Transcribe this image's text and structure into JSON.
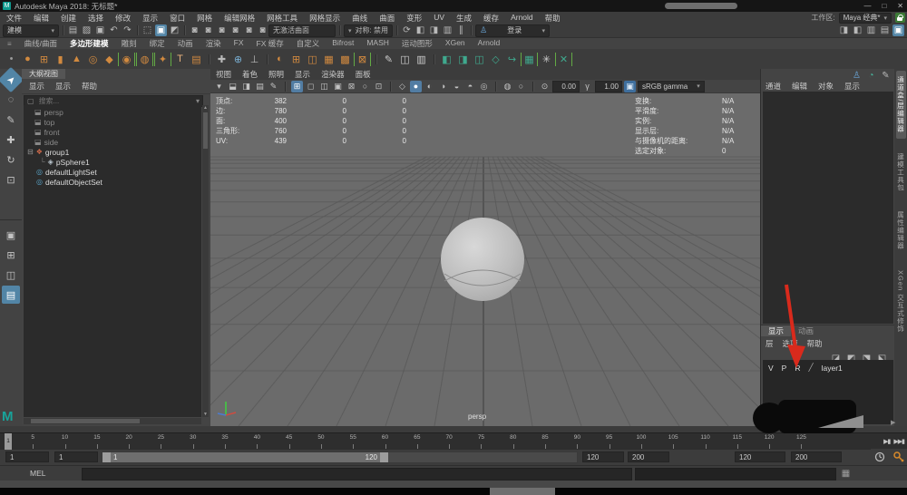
{
  "window": {
    "app_icon": "M",
    "title": "Autodesk Maya 2018: 无标题*",
    "minimize": "—",
    "maximize": "□",
    "close": "✕"
  },
  "menu_bar": {
    "items": [
      "文件",
      "编辑",
      "创建",
      "选择",
      "修改",
      "显示",
      "窗口",
      "网格",
      "编辑网格",
      "网格工具",
      "网格显示",
      "曲线",
      "曲面",
      "变形",
      "UV",
      "生成",
      "缓存",
      "Arnold",
      "帮助"
    ],
    "workspace_label": "工作区:",
    "workspace_value": "Maya 经典*"
  },
  "status_line": {
    "mode": "建模",
    "file_icons": [
      {
        "n": "new-scene-icon",
        "g": "▤"
      },
      {
        "n": "open-scene-icon",
        "g": "▨"
      },
      {
        "n": "save-scene-icon",
        "g": "▣"
      },
      {
        "n": "undo-icon",
        "g": "↶"
      },
      {
        "n": "redo-icon",
        "g": "↷"
      }
    ],
    "select_icons": [
      {
        "n": "select-hierarchy-icon",
        "g": "⬚"
      },
      {
        "n": "select-object-icon",
        "g": "▣",
        "hl": true
      },
      {
        "n": "select-component-icon",
        "g": "◩"
      }
    ],
    "snap_icons": [
      {
        "n": "snap-grid-icon",
        "g": "◙"
      },
      {
        "n": "snap-curve-icon",
        "g": "◙"
      },
      {
        "n": "snap-point-icon",
        "g": "◙"
      },
      {
        "n": "snap-projected-center-icon",
        "g": "◙"
      },
      {
        "n": "snap-view-plane-icon",
        "g": "◙"
      },
      {
        "n": "make-live-icon",
        "g": "◙"
      }
    ],
    "no_active_surface": "无激活曲面",
    "symmetry": "对称: 禁用",
    "render_icons": [
      {
        "n": "construction-history-icon",
        "g": "⟳"
      },
      {
        "n": "render-frame-icon",
        "g": "◧"
      },
      {
        "n": "ipr-render-icon",
        "g": "◨"
      },
      {
        "n": "render-settings-icon",
        "g": "▥"
      },
      {
        "n": "pause-icon",
        "g": "∥"
      }
    ],
    "login": "登录",
    "right_icons": [
      {
        "n": "attribute-editor-toggle-icon",
        "g": "◨"
      },
      {
        "n": "tool-settings-toggle-icon",
        "g": "◧"
      },
      {
        "n": "channel-box-toggle-icon",
        "g": "▥"
      },
      {
        "n": "modeling-toolkit-toggle-icon",
        "g": "▤"
      },
      {
        "n": "outliner-toggle-icon",
        "g": "▣",
        "hl": true
      }
    ]
  },
  "shelf": {
    "active_tab": "多边形建模",
    "tabs": [
      "曲线/曲面",
      "多边形建模",
      "雕刻",
      "绑定",
      "动画",
      "渲染",
      "FX",
      "FX 缓存",
      "自定义",
      "Bifrost",
      "MASH",
      "运动图形",
      "XGen",
      "Arnold"
    ],
    "icons": [
      {
        "n": "shelf-popup-icon",
        "g": "•",
        "c": "#9a9a9a"
      },
      {
        "n": "poly-sphere-icon",
        "g": "●",
        "c": "#d28a3f"
      },
      {
        "n": "poly-cube-icon",
        "g": "⊞",
        "c": "#d28a3f"
      },
      {
        "n": "poly-cylinder-icon",
        "g": "▮",
        "c": "#d28a3f"
      },
      {
        "n": "poly-cone-icon",
        "g": "▲",
        "c": "#d28a3f"
      },
      {
        "n": "poly-torus-icon",
        "g": "◎",
        "c": "#d28a3f"
      },
      {
        "n": "poly-plane-icon",
        "g": "◆",
        "c": "#d28a3f"
      },
      {
        "n": "poly-disc-icon",
        "g": "◉",
        "c": "#d28a3f",
        "br": true
      },
      {
        "n": "poly-platonic-icon",
        "g": "◍",
        "c": "#d28a3f",
        "br": true
      },
      {
        "n": "poly-superellipse-icon",
        "g": "✦",
        "c": "#d28a3f",
        "br": true
      },
      {
        "n": "poly-type-icon",
        "g": "T",
        "c": "#e8b27d"
      },
      {
        "n": "svg-tool-icon",
        "g": "▤",
        "c": "#d28a3f"
      },
      {
        "n": "sep"
      },
      {
        "n": "construction-plane-icon",
        "g": "✚",
        "c": "#b9b9b9"
      },
      {
        "n": "locator-icon",
        "g": "⊕",
        "c": "#7ab0d4"
      },
      {
        "n": "measure-distance-icon",
        "g": "⊥",
        "c": "#b9b9b9"
      },
      {
        "n": "sep"
      },
      {
        "n": "mirror-icon",
        "g": "◐",
        "c": "#d28a3f"
      },
      {
        "n": "combine-icon",
        "g": "⊞",
        "c": "#d28a3f"
      },
      {
        "n": "separate-icon",
        "g": "◫",
        "c": "#d28a3f"
      },
      {
        "n": "smooth-icon",
        "g": "▦",
        "c": "#d28a3f"
      },
      {
        "n": "reduce-icon",
        "g": "▩",
        "c": "#d28a3f"
      },
      {
        "n": "boolean-icon",
        "g": "⊠",
        "c": "#d28a3f",
        "br": true
      },
      {
        "n": "sep"
      },
      {
        "n": "quad-draw-icon",
        "g": "✎",
        "c": "#cccccc"
      },
      {
        "n": "multi-cut-icon",
        "g": "◫",
        "c": "#cccccc"
      },
      {
        "n": "insert-edge-loop-icon",
        "g": "▥",
        "c": "#cccccc"
      },
      {
        "n": "sep"
      },
      {
        "n": "extrude-icon",
        "g": "◧",
        "c": "#3fa98e"
      },
      {
        "n": "bevel-icon",
        "g": "◨",
        "c": "#3fa98e"
      },
      {
        "n": "bridge-icon",
        "g": "◫",
        "c": "#3fa98e"
      },
      {
        "n": "project-curve-icon",
        "g": "◇",
        "c": "#3fa98e"
      },
      {
        "n": "curve-to-poly-icon",
        "g": "↪",
        "c": "#3fa98e"
      },
      {
        "n": "sculpt-icon",
        "g": "▦",
        "c": "#3fa98e",
        "br": true
      },
      {
        "n": "symmetrize-icon",
        "g": "✳",
        "c": "#cfcfcf"
      },
      {
        "n": "delete-history-icon",
        "g": "✕",
        "c": "#3fa98e",
        "br": true
      }
    ]
  },
  "toolbox": {
    "logo": "M",
    "tools": [
      {
        "n": "select-tool",
        "g": "➤",
        "hl": true
      },
      {
        "n": "lasso-select-tool",
        "g": "◌"
      },
      {
        "n": "paint-select-tool",
        "g": "✎"
      },
      {
        "n": "move-tool",
        "g": "✚"
      },
      {
        "n": "rotate-tool",
        "g": "↻"
      },
      {
        "n": "scale-tool",
        "g": "⊡"
      }
    ],
    "layouts": [
      {
        "n": "single-pane-layout-button",
        "g": "▣"
      },
      {
        "n": "four-pane-layout-button",
        "g": "⊞"
      },
      {
        "n": "two-pane-layout-button",
        "g": "◫"
      },
      {
        "n": "preset-layout-button",
        "g": "▤",
        "hl": true
      }
    ]
  },
  "outliner": {
    "title": "大纲视图",
    "menus": [
      "显示",
      "显示",
      "帮助"
    ],
    "search_placeholder": "搜索...",
    "items": [
      {
        "label": "persp",
        "icon": "camera-icon",
        "glyph": "⬓",
        "color": "#888888",
        "pad": 12,
        "dim": true
      },
      {
        "label": "top",
        "icon": "camera-icon",
        "glyph": "⬓",
        "color": "#888888",
        "pad": 12,
        "dim": true
      },
      {
        "label": "front",
        "icon": "camera-icon",
        "glyph": "⬓",
        "color": "#888888",
        "pad": 12,
        "dim": true
      },
      {
        "label": "side",
        "icon": "camera-icon",
        "glyph": "⬓",
        "color": "#888888",
        "pad": 12,
        "dim": true
      },
      {
        "label": "group1",
        "icon": "group-icon",
        "glyph": "❖",
        "color": "#cf6a4a",
        "pad": 4,
        "exp": true
      },
      {
        "label": "pSphere1",
        "icon": "mesh-icon",
        "glyph": "◈",
        "color": "#b8c4cc",
        "pad": 18,
        "conn": true
      },
      {
        "label": "defaultLightSet",
        "icon": "set-icon",
        "glyph": "◎",
        "color": "#57a0c4",
        "pad": 14
      },
      {
        "label": "defaultObjectSet",
        "icon": "set-icon",
        "glyph": "◎",
        "color": "#57a0c4",
        "pad": 14
      }
    ]
  },
  "viewport": {
    "menus": [
      "视图",
      "着色",
      "照明",
      "显示",
      "渲染器",
      "面板"
    ],
    "icons": [
      {
        "n": "select-camera-icon",
        "g": "▾"
      },
      {
        "n": "lock-camera-icon",
        "g": "⬓"
      },
      {
        "n": "camera-attributes-icon",
        "g": "◨"
      },
      {
        "n": "bookmark-icon",
        "g": "▤"
      },
      {
        "n": "grease-pencil-icon",
        "g": "✎"
      },
      {
        "n": "sep"
      },
      {
        "n": "grid-icon",
        "g": "⊞",
        "hl": true
      },
      {
        "n": "film-gate-icon",
        "g": "◻"
      },
      {
        "n": "resolution-gate-icon",
        "g": "◫"
      },
      {
        "n": "gate-mask-icon",
        "g": "▣"
      },
      {
        "n": "field-chart-icon",
        "g": "⊠"
      },
      {
        "n": "safe-action-icon",
        "g": "○"
      },
      {
        "n": "safe-title-icon",
        "g": "⊡"
      },
      {
        "n": "sep"
      },
      {
        "n": "wireframe-icon",
        "g": "◇"
      },
      {
        "n": "smooth-shade-icon",
        "g": "●",
        "hl": true
      },
      {
        "n": "textured-icon",
        "g": "◐"
      },
      {
        "n": "use-all-lights-icon",
        "g": "◑"
      },
      {
        "n": "shadows-icon",
        "g": "◒"
      },
      {
        "n": "ambient-occlusion-icon",
        "g": "◓"
      },
      {
        "n": "motion-blur-icon",
        "g": "◎"
      },
      {
        "n": "sep"
      },
      {
        "n": "isolate-select-icon",
        "g": "◍"
      },
      {
        "n": "xray-icon",
        "g": "○"
      },
      {
        "n": "sep"
      },
      {
        "n": "exposure-icon",
        "g": "⊙"
      }
    ],
    "exposure": "0.00",
    "gamma_icon": "γ",
    "gamma": "1.00",
    "colorspace": "sRGB gamma",
    "camera": "persp",
    "hud_left": [
      {
        "label": "顶点:",
        "total": "382",
        "c2": "0",
        "c3": "0"
      },
      {
        "label": "边:",
        "total": "780",
        "c2": "0",
        "c3": "0"
      },
      {
        "label": "面:",
        "total": "400",
        "c2": "0",
        "c3": "0"
      },
      {
        "label": "三角形:",
        "total": "760",
        "c2": "0",
        "c3": "0"
      },
      {
        "label": "UV:",
        "total": "439",
        "c2": "0",
        "c3": "0"
      }
    ],
    "hud_right": [
      {
        "label": "变换:",
        "value": "N/A"
      },
      {
        "label": "平滑度:",
        "value": "N/A"
      },
      {
        "label": "实例:",
        "value": "N/A"
      },
      {
        "label": "显示层:",
        "value": "N/A"
      },
      {
        "label": "与摄像机的距离:",
        "value": "N/A"
      },
      {
        "label": "选定对象:",
        "value": "0"
      }
    ]
  },
  "channel_box": {
    "menus": [
      "通道",
      "编辑",
      "对象",
      "显示"
    ],
    "top_icons": [
      {
        "n": "character-icon",
        "g": "♙",
        "c": "#6aa6d8"
      },
      {
        "n": "speed-icon",
        "g": "◔",
        "c": "#49b39a"
      },
      {
        "n": "edit-icon",
        "g": "✎",
        "c": "#b9b9b9"
      }
    ]
  },
  "sidebar_tabs": [
    {
      "label": "通道盒/层编辑器",
      "active": true
    },
    {
      "label": "建模工具包",
      "active": false
    },
    {
      "label": "属性编辑器",
      "active": false
    },
    {
      "label": "XGen 交互式修饰",
      "active": false
    }
  ],
  "layer_editor": {
    "tabs": [
      "显示",
      "动画"
    ],
    "menus": [
      "层",
      "选项",
      "帮助"
    ],
    "icons": [
      {
        "n": "move-layer-up-icon",
        "g": "◪"
      },
      {
        "n": "move-layer-down-icon",
        "g": "◩"
      },
      {
        "n": "new-empty-layer-icon",
        "g": "⬔"
      },
      {
        "n": "new-layer-from-selected-icon",
        "g": "⬕"
      }
    ],
    "layer": {
      "toggles": [
        "V",
        "P",
        "R"
      ],
      "swatch": "╱",
      "name": "layer1"
    }
  },
  "time_slider": {
    "current_frame": "1",
    "ticks": [
      5,
      10,
      15,
      20,
      25,
      30,
      35,
      40,
      45,
      50,
      55,
      60,
      65,
      70,
      75,
      80,
      85,
      90,
      95,
      100,
      105,
      110,
      115,
      120,
      125
    ],
    "playback": [
      {
        "n": "step-forward-button",
        "g": "▶▮"
      },
      {
        "n": "go-to-end-button",
        "g": "▶▶▮"
      }
    ]
  },
  "range_slider": {
    "anim_start": "1",
    "playback_start": "1",
    "handle_start": "1",
    "handle_end": "120",
    "playback_end": "120",
    "anim_end": "200",
    "alt_end": "120",
    "alt_anim_end": "200"
  },
  "command_line": {
    "label": "MEL"
  },
  "colors": {
    "accent": "#5285a6",
    "shelf_orange": "#d28a3f",
    "shelf_teal": "#3fa98e",
    "arrow_red": "#d92a1c",
    "viewport_bg": "#6b6b6b"
  }
}
